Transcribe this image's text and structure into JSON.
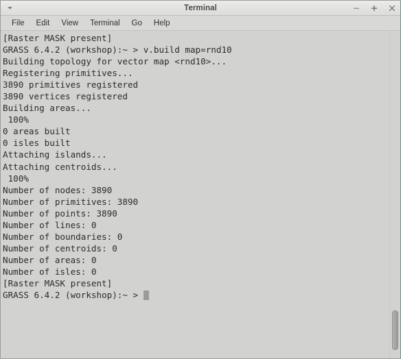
{
  "window": {
    "title": "Terminal",
    "menu_button_icon": "chevron-down-icon",
    "controls": [
      {
        "name": "minimize-button",
        "glyph": "minimize-icon",
        "label": "−"
      },
      {
        "name": "maximize-button",
        "glyph": "maximize-icon",
        "label": "+"
      },
      {
        "name": "close-button",
        "glyph": "close-icon",
        "label": "×"
      }
    ]
  },
  "menubar": {
    "items": [
      {
        "label": "File"
      },
      {
        "label": "Edit"
      },
      {
        "label": "View"
      },
      {
        "label": "Terminal"
      },
      {
        "label": "Go"
      },
      {
        "label": "Help"
      }
    ]
  },
  "terminal": {
    "background_color": "#d2d2d0",
    "text_color": "#2b2b2b",
    "cursor_color": "#9a9a98",
    "lines": [
      "[Raster MASK present]",
      "GRASS 6.4.2 (workshop):~ > v.build map=rnd10",
      "Building topology for vector map <rnd10>...",
      "Registering primitives...",
      "3890 primitives registered",
      "3890 vertices registered",
      "Building areas...",
      " 100%",
      "0 areas built",
      "0 isles built",
      "Attaching islands...",
      "Attaching centroids...",
      " 100%",
      "Number of nodes: 3890",
      "Number of primitives: 3890",
      "Number of points: 3890",
      "Number of lines: 0",
      "Number of boundaries: 0",
      "Number of centroids: 0",
      "Number of areas: 0",
      "Number of isles: 0",
      "[Raster MASK present]"
    ],
    "prompt_line": "GRASS 6.4.2 (workshop):~ > ",
    "command_entered": "v.build map=rnd10",
    "map_name": "rnd10",
    "shell_version": "GRASS 6.4.2",
    "location": "workshop",
    "stats": {
      "nodes": 3890,
      "primitives": 3890,
      "points": 3890,
      "lines": 0,
      "boundaries": 0,
      "centroids": 0,
      "areas": 0,
      "isles": 0,
      "areas_built": 0,
      "isles_built": 0,
      "vertices_registered": 3890,
      "progress": "100%"
    }
  },
  "scrollbar": {
    "name": "vertical-scrollbar",
    "position": "bottom"
  }
}
